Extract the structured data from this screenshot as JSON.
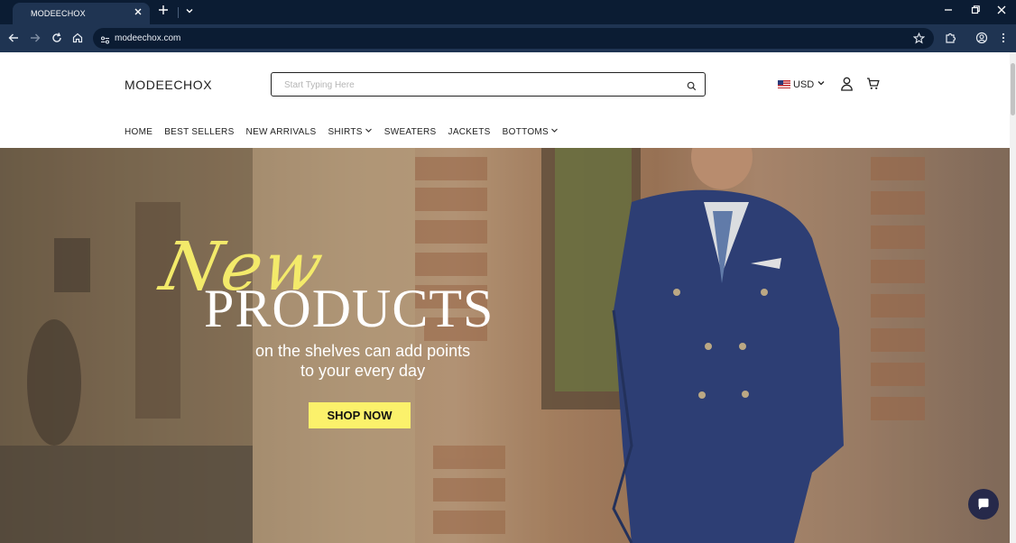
{
  "browser": {
    "tab_title": "MODEECHOX",
    "url": "modeechox.com"
  },
  "store": {
    "logo": "MODEECHOX",
    "search_placeholder": "Start Typing Here",
    "currency": "USD"
  },
  "nav": {
    "items": [
      {
        "label": "HOME"
      },
      {
        "label": "BEST SELLERS"
      },
      {
        "label": "NEW ARRIVALS"
      },
      {
        "label": "SHIRTS"
      },
      {
        "label": "SWEATERS"
      },
      {
        "label": "JACKETS"
      },
      {
        "label": "BOTTOMS"
      }
    ]
  },
  "hero": {
    "script_text": "New",
    "title": "PRODUCTS",
    "subtitle_line1": "on the shelves can add points",
    "subtitle_line2": "to your every day",
    "button": "SHOP NOW"
  },
  "colors": {
    "accent_yellow": "#fbf16b",
    "browser_dark": "#0b1c33",
    "browser_toolbar": "#1f3452",
    "chat_button": "#26294a"
  },
  "icons": [
    "close-icon",
    "plus-icon",
    "chevron-down-icon",
    "minimize-icon",
    "restore-icon",
    "back-icon",
    "forward-icon",
    "reload-icon",
    "home-icon",
    "site-info-icon",
    "star-icon",
    "extensions-icon",
    "profile-icon",
    "kebab-menu-icon",
    "search-icon",
    "user-icon",
    "cart-icon",
    "chat-icon"
  ]
}
